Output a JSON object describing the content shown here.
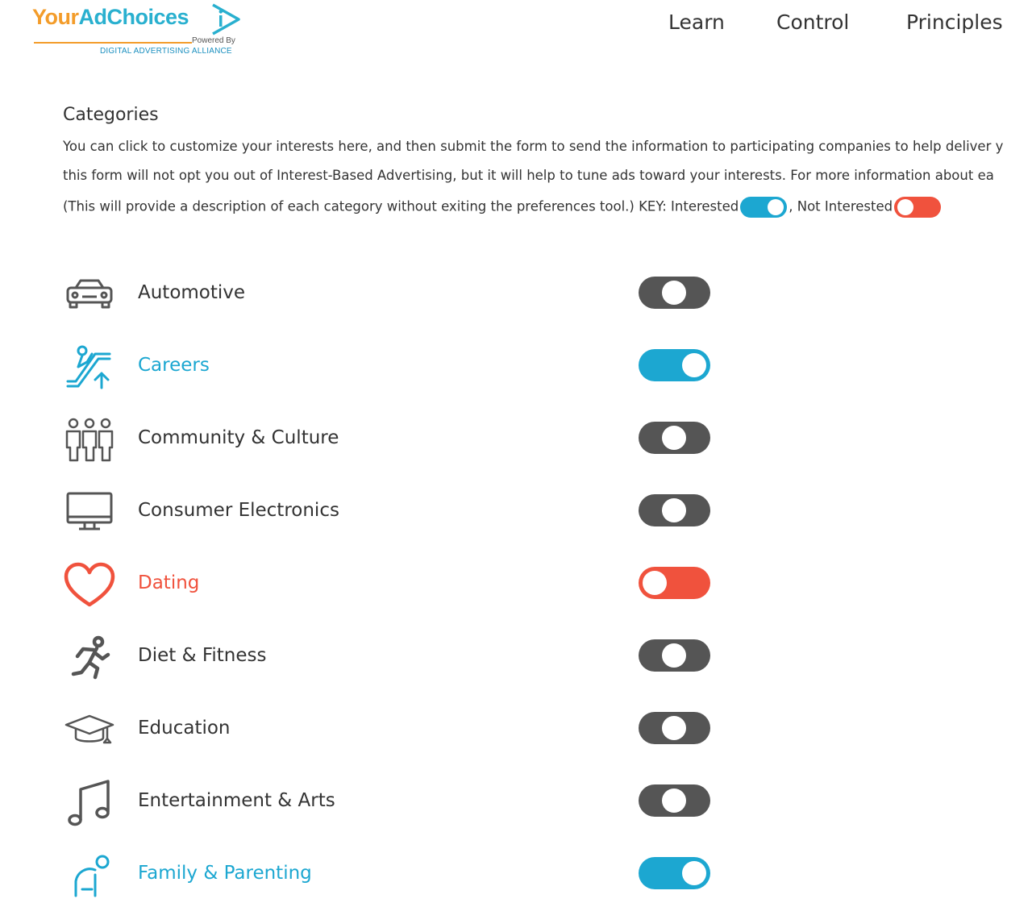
{
  "header": {
    "logo": {
      "your": "Your",
      "adchoices": "AdChoices",
      "powered_by": "Powered By",
      "alliance": "DIGITAL ADVERTISING ALLIANCE"
    },
    "nav": [
      {
        "label": "Learn"
      },
      {
        "label": "Control"
      },
      {
        "label": "Principles"
      }
    ]
  },
  "intro": {
    "title": "Categories",
    "line1": "You can click to customize your interests here, and then submit the form to send the information to participating companies to help deliver y",
    "line2": "this form will not opt you out of Interest-Based Advertising, but it will help to tune ads toward your interests. For more information about ea",
    "line3_a": "(This will provide a description of each category without exiting the preferences tool.) KEY: Interested",
    "line3_b": ", Not Interested"
  },
  "colors": {
    "interested": "#1ca7d1",
    "not_interested": "#f0523d",
    "neutral": "#555555",
    "text": "#333333"
  },
  "categories": [
    {
      "label": "Automotive",
      "icon": "car-icon",
      "state": "neutral"
    },
    {
      "label": "Careers",
      "icon": "escalator-icon",
      "state": "interested"
    },
    {
      "label": "Community & Culture",
      "icon": "people-group-icon",
      "state": "neutral"
    },
    {
      "label": "Consumer Electronics",
      "icon": "monitor-icon",
      "state": "neutral"
    },
    {
      "label": "Dating",
      "icon": "heart-icon",
      "state": "not_interested"
    },
    {
      "label": "Diet & Fitness",
      "icon": "runner-icon",
      "state": "neutral"
    },
    {
      "label": "Education",
      "icon": "graduation-cap-icon",
      "state": "neutral"
    },
    {
      "label": "Entertainment & Arts",
      "icon": "music-note-icon",
      "state": "neutral"
    },
    {
      "label": "Family & Parenting",
      "icon": "family-icon",
      "state": "interested"
    }
  ]
}
